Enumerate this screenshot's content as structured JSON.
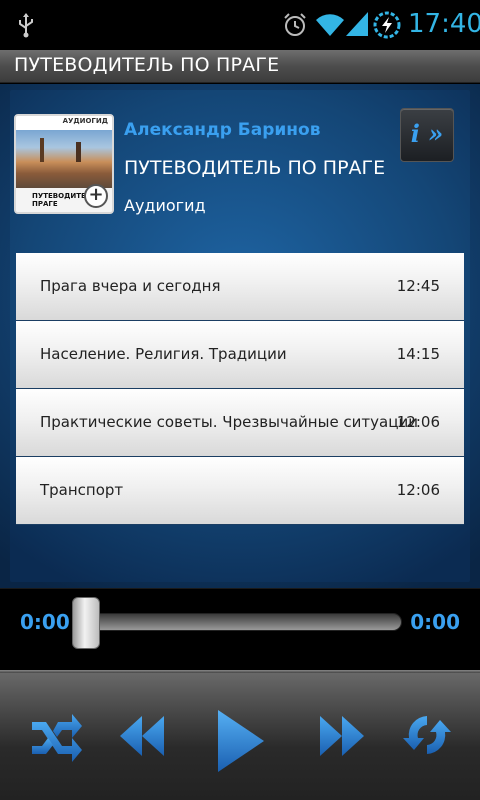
{
  "status_bar": {
    "clock": "17:40",
    "icons": [
      "usb-icon",
      "alarm-icon",
      "wifi-icon",
      "signal-icon",
      "battery-charging-icon"
    ],
    "accent_color": "#33b5e5"
  },
  "title_bar": {
    "title": "ПУТЕВОДИТЕЛЬ ПО ПРАГЕ"
  },
  "book": {
    "author": "Александр Баринов",
    "title": "ПУТЕВОДИТЕЛЬ ПО ПРАГЕ",
    "type": "Аудиогид",
    "cover_publisher": "АУДИОГИД",
    "cover_title": "ПУТЕВОДИТЕЛЬ ПРАГЕ",
    "info_button": "i »"
  },
  "chapters": [
    {
      "name": "Прага вчера и сегодня",
      "duration": "12:45"
    },
    {
      "name": "Население. Религия. Традиции",
      "duration": "14:15"
    },
    {
      "name": "Практические советы. Чрезвычайные ситуации",
      "duration": "12:06"
    },
    {
      "name": "Транспорт",
      "duration": "12:06"
    }
  ],
  "player": {
    "elapsed": "0:00",
    "remaining": "0:00",
    "progress": 0,
    "controls": [
      "shuffle-icon",
      "rewind-icon",
      "play-icon",
      "fast-forward-icon",
      "repeat-icon"
    ]
  },
  "colors": {
    "accent": "#3aa0f0",
    "panel_blue": "#1e64a3"
  }
}
